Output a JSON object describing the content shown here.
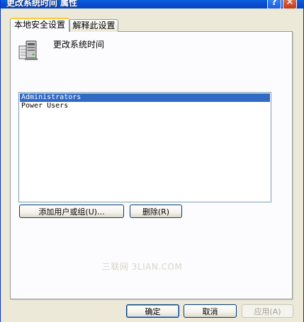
{
  "window": {
    "title": "更改系统时间 属性",
    "help_label": "?",
    "close_label": "✕"
  },
  "tabs": [
    {
      "label": "本地安全设置",
      "active": true
    },
    {
      "label": "解释此设置",
      "active": false
    }
  ],
  "policy": {
    "icon": "server-policy-icon",
    "name": "更改系统时间"
  },
  "members": {
    "items": [
      {
        "label": "Administrators",
        "selected": true
      },
      {
        "label": "Power Users",
        "selected": false
      }
    ]
  },
  "actions": {
    "add_label": "添加用户或组(U)...",
    "remove_label": "删除(R)"
  },
  "footer": {
    "ok_label": "确定",
    "cancel_label": "取消",
    "apply_label": "应用(A)"
  },
  "watermark": "三联网 3LIAN.COM",
  "colors": {
    "titlebar": "#0a5fdc",
    "selection": "#316ac5",
    "tab_highlight": "#ffc83c",
    "face": "#ece9d8"
  }
}
